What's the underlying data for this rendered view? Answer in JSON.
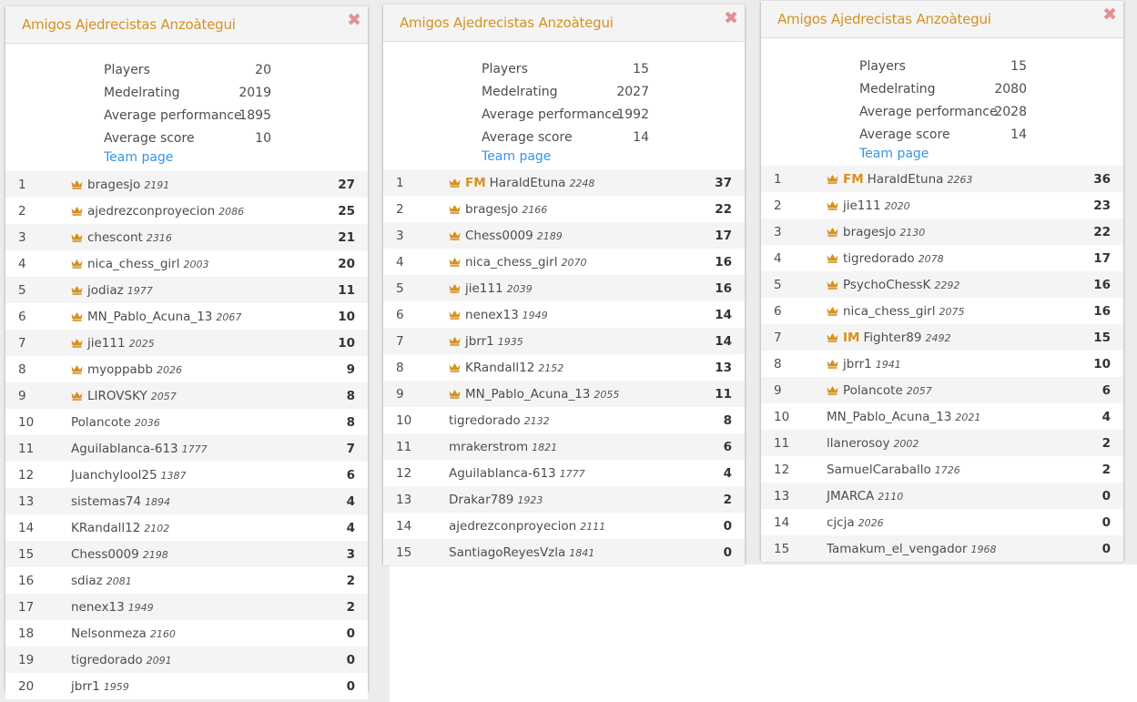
{
  "panels": [
    {
      "title": "Amigos Ajedrecistas Anzoàtegui",
      "close_icon": "close-icon",
      "stats": [
        {
          "label": "Players",
          "value": "20"
        },
        {
          "label": "Medelrating",
          "value": "2019"
        },
        {
          "label": "Average performance",
          "value": "1895"
        },
        {
          "label": "Average score",
          "value": "10"
        }
      ],
      "team_page_label": "Team page",
      "players": [
        {
          "rank": "1",
          "crown": true,
          "title": "",
          "name": "bragesjo",
          "rating": "2191",
          "score": "27"
        },
        {
          "rank": "2",
          "crown": true,
          "title": "",
          "name": "ajedrezconproyecion",
          "rating": "2086",
          "score": "25"
        },
        {
          "rank": "3",
          "crown": true,
          "title": "",
          "name": "chescont",
          "rating": "2316",
          "score": "21"
        },
        {
          "rank": "4",
          "crown": true,
          "title": "",
          "name": "nica_chess_girl",
          "rating": "2003",
          "score": "20"
        },
        {
          "rank": "5",
          "crown": true,
          "title": "",
          "name": "jodiaz",
          "rating": "1977",
          "score": "11"
        },
        {
          "rank": "6",
          "crown": true,
          "title": "",
          "name": "MN_Pablo_Acuna_13",
          "rating": "2067",
          "score": "10"
        },
        {
          "rank": "7",
          "crown": true,
          "title": "",
          "name": "jie111",
          "rating": "2025",
          "score": "10"
        },
        {
          "rank": "8",
          "crown": true,
          "title": "",
          "name": "myoppabb",
          "rating": "2026",
          "score": "9"
        },
        {
          "rank": "9",
          "crown": true,
          "title": "",
          "name": "LIROVSKY",
          "rating": "2057",
          "score": "8"
        },
        {
          "rank": "10",
          "crown": false,
          "title": "",
          "name": "Polancote",
          "rating": "2036",
          "score": "8"
        },
        {
          "rank": "11",
          "crown": false,
          "title": "",
          "name": "Aguilablanca-613",
          "rating": "1777",
          "score": "7"
        },
        {
          "rank": "12",
          "crown": false,
          "title": "",
          "name": "Juanchylool25",
          "rating": "1387",
          "score": "6"
        },
        {
          "rank": "13",
          "crown": false,
          "title": "",
          "name": "sistemas74",
          "rating": "1894",
          "score": "4"
        },
        {
          "rank": "14",
          "crown": false,
          "title": "",
          "name": "KRandall12",
          "rating": "2102",
          "score": "4"
        },
        {
          "rank": "15",
          "crown": false,
          "title": "",
          "name": "Chess0009",
          "rating": "2198",
          "score": "3"
        },
        {
          "rank": "16",
          "crown": false,
          "title": "",
          "name": "sdiaz",
          "rating": "2081",
          "score": "2"
        },
        {
          "rank": "17",
          "crown": false,
          "title": "",
          "name": "nenex13",
          "rating": "1949",
          "score": "2"
        },
        {
          "rank": "18",
          "crown": false,
          "title": "",
          "name": "Nelsonmeza",
          "rating": "2160",
          "score": "0"
        },
        {
          "rank": "19",
          "crown": false,
          "title": "",
          "name": "tigredorado",
          "rating": "2091",
          "score": "0"
        },
        {
          "rank": "20",
          "crown": false,
          "title": "",
          "name": "jbrr1",
          "rating": "1959",
          "score": "0"
        }
      ]
    },
    {
      "title": "Amigos Ajedrecistas Anzoàtegui",
      "close_icon": "close-icon",
      "stats": [
        {
          "label": "Players",
          "value": "15"
        },
        {
          "label": "Medelrating",
          "value": "2027"
        },
        {
          "label": "Average performance",
          "value": "1992"
        },
        {
          "label": "Average score",
          "value": "14"
        }
      ],
      "team_page_label": "Team page",
      "players": [
        {
          "rank": "1",
          "crown": true,
          "title": "FM",
          "name": "HaraldEtuna",
          "rating": "2248",
          "score": "37"
        },
        {
          "rank": "2",
          "crown": true,
          "title": "",
          "name": "bragesjo",
          "rating": "2166",
          "score": "22"
        },
        {
          "rank": "3",
          "crown": true,
          "title": "",
          "name": "Chess0009",
          "rating": "2189",
          "score": "17"
        },
        {
          "rank": "4",
          "crown": true,
          "title": "",
          "name": "nica_chess_girl",
          "rating": "2070",
          "score": "16"
        },
        {
          "rank": "5",
          "crown": true,
          "title": "",
          "name": "jie111",
          "rating": "2039",
          "score": "16"
        },
        {
          "rank": "6",
          "crown": true,
          "title": "",
          "name": "nenex13",
          "rating": "1949",
          "score": "14"
        },
        {
          "rank": "7",
          "crown": true,
          "title": "",
          "name": "jbrr1",
          "rating": "1935",
          "score": "14"
        },
        {
          "rank": "8",
          "crown": true,
          "title": "",
          "name": "KRandall12",
          "rating": "2152",
          "score": "13"
        },
        {
          "rank": "9",
          "crown": true,
          "title": "",
          "name": "MN_Pablo_Acuna_13",
          "rating": "2055",
          "score": "11"
        },
        {
          "rank": "10",
          "crown": false,
          "title": "",
          "name": "tigredorado",
          "rating": "2132",
          "score": "8"
        },
        {
          "rank": "11",
          "crown": false,
          "title": "",
          "name": "mrakerstrom",
          "rating": "1821",
          "score": "6"
        },
        {
          "rank": "12",
          "crown": false,
          "title": "",
          "name": "Aguilablanca-613",
          "rating": "1777",
          "score": "4"
        },
        {
          "rank": "13",
          "crown": false,
          "title": "",
          "name": "Drakar789",
          "rating": "1923",
          "score": "2"
        },
        {
          "rank": "14",
          "crown": false,
          "title": "",
          "name": "ajedrezconproyecion",
          "rating": "2111",
          "score": "0"
        },
        {
          "rank": "15",
          "crown": false,
          "title": "",
          "name": "SantiagoReyesVzla",
          "rating": "1841",
          "score": "0"
        }
      ]
    },
    {
      "title": "Amigos Ajedrecistas Anzoàtegui",
      "close_icon": "close-icon",
      "stats": [
        {
          "label": "Players",
          "value": "15"
        },
        {
          "label": "Medelrating",
          "value": "2080"
        },
        {
          "label": "Average performance",
          "value": "2028"
        },
        {
          "label": "Average score",
          "value": "14"
        }
      ],
      "team_page_label": "Team page",
      "players": [
        {
          "rank": "1",
          "crown": true,
          "title": "FM",
          "name": "HaraldEtuna",
          "rating": "2263",
          "score": "36"
        },
        {
          "rank": "2",
          "crown": true,
          "title": "",
          "name": "jie111",
          "rating": "2020",
          "score": "23"
        },
        {
          "rank": "3",
          "crown": true,
          "title": "",
          "name": "bragesjo",
          "rating": "2130",
          "score": "22"
        },
        {
          "rank": "4",
          "crown": true,
          "title": "",
          "name": "tigredorado",
          "rating": "2078",
          "score": "17"
        },
        {
          "rank": "5",
          "crown": true,
          "title": "",
          "name": "PsychoChessK",
          "rating": "2292",
          "score": "16"
        },
        {
          "rank": "6",
          "crown": true,
          "title": "",
          "name": "nica_chess_girl",
          "rating": "2075",
          "score": "16"
        },
        {
          "rank": "7",
          "crown": true,
          "title": "IM",
          "name": "Fighter89",
          "rating": "2492",
          "score": "15"
        },
        {
          "rank": "8",
          "crown": true,
          "title": "",
          "name": "jbrr1",
          "rating": "1941",
          "score": "10"
        },
        {
          "rank": "9",
          "crown": true,
          "title": "",
          "name": "Polancote",
          "rating": "2057",
          "score": "6"
        },
        {
          "rank": "10",
          "crown": false,
          "title": "",
          "name": "MN_Pablo_Acuna_13",
          "rating": "2021",
          "score": "4"
        },
        {
          "rank": "11",
          "crown": false,
          "title": "",
          "name": "llanerosoy",
          "rating": "2002",
          "score": "2"
        },
        {
          "rank": "12",
          "crown": false,
          "title": "",
          "name": "SamuelCaraballo",
          "rating": "1726",
          "score": "2"
        },
        {
          "rank": "13",
          "crown": false,
          "title": "",
          "name": "JMARCA",
          "rating": "2110",
          "score": "0"
        },
        {
          "rank": "14",
          "crown": false,
          "title": "",
          "name": "cjcja",
          "rating": "2026",
          "score": "0"
        },
        {
          "rank": "15",
          "crown": false,
          "title": "",
          "name": "Tamakum_el_vengador",
          "rating": "1968",
          "score": "0"
        }
      ]
    }
  ],
  "colors": {
    "accent": "#d59120",
    "link": "#3893e8",
    "close": "#e09090",
    "row_alt": "#f4f4f4"
  }
}
